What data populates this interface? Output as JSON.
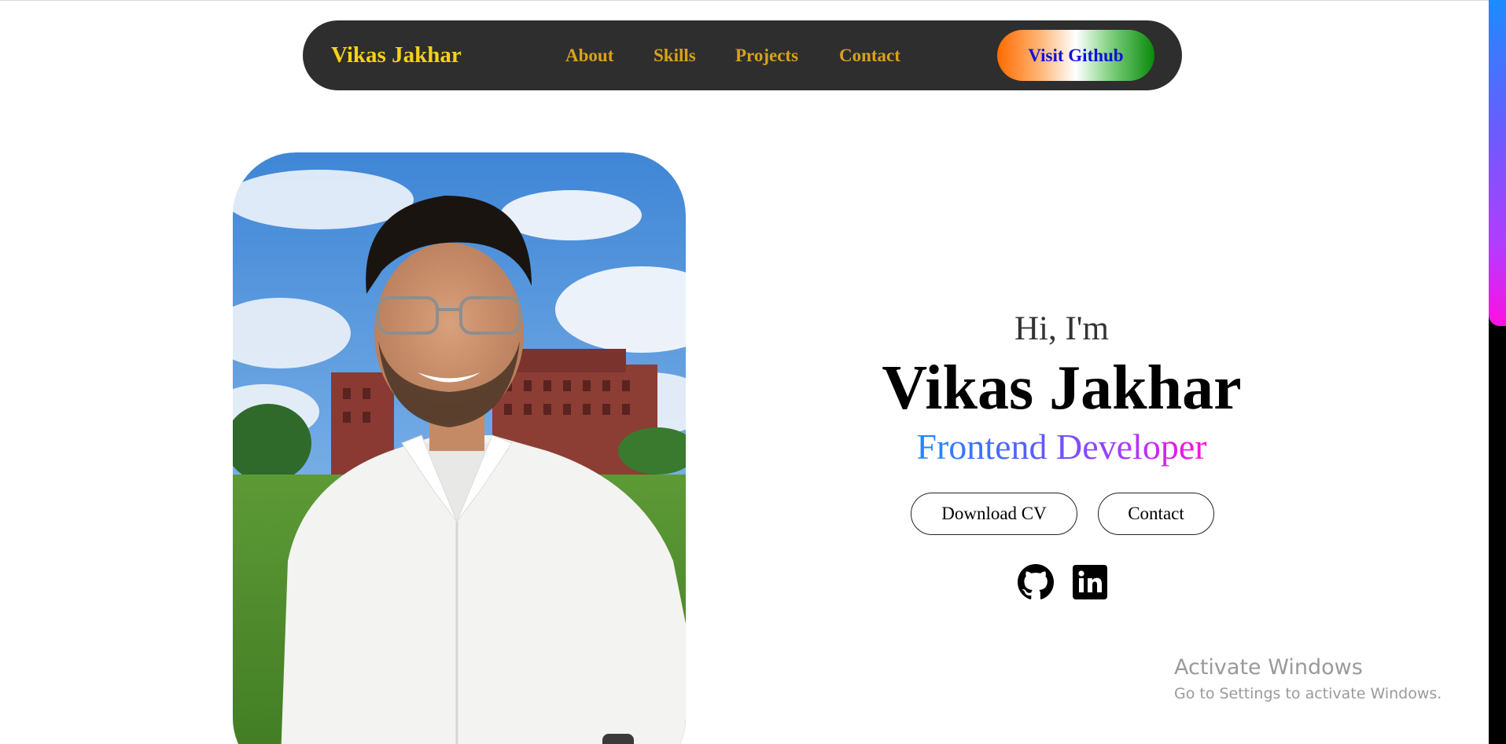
{
  "navbar": {
    "brand": "Vikas Jakhar",
    "links": [
      {
        "label": "About"
      },
      {
        "label": "Skills"
      },
      {
        "label": "Projects"
      },
      {
        "label": "Contact"
      }
    ],
    "github_button": "Visit Github"
  },
  "hero": {
    "greeting": "Hi, I'm",
    "name": "Vikas Jakhar",
    "role": "Frontend Developer",
    "download_cv": "Download CV",
    "contact": "Contact",
    "social_icons": [
      "github-icon",
      "linkedin-icon"
    ]
  },
  "watermark": {
    "title": "Activate Windows",
    "subtitle": "Go to Settings to activate Windows."
  },
  "colors": {
    "navbar_bg": "#2e2e2e",
    "brand": "#f6d312",
    "nav_link": "#d7a21b",
    "github_text": "#1010d8",
    "role_gradient": [
      "#1e8bff",
      "#a23dff",
      "#ff10d8"
    ]
  }
}
